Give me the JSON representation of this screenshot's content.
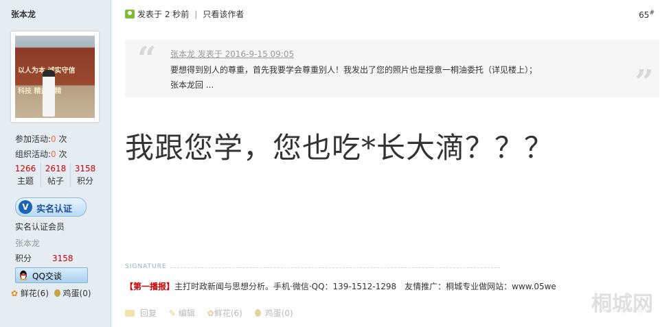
{
  "sidebar": {
    "username": "张本龙",
    "activities": {
      "joined_label": "参加活动:",
      "joined_value": "0",
      "joined_unit": " 次",
      "organized_label": "组织活动:",
      "organized_value": "0",
      "organized_unit": " 次"
    },
    "counts": [
      {
        "value": "1266",
        "label": "主题"
      },
      {
        "value": "2618",
        "label": "帖子"
      },
      {
        "value": "3158",
        "label": "积分"
      }
    ],
    "verify_badge": "实名认证",
    "member_type": "实名认证会员",
    "name_grey": "张本龙",
    "points_label": "积分",
    "points_value": "3158",
    "qq_button": "QQ交谈",
    "flowers": "鲜花(6)",
    "eggs": "鸡蛋(0)"
  },
  "post": {
    "posted_label": "发表于 2 秒前",
    "author_only": "只看该作者",
    "floor_number": "65",
    "floor_mark": "#",
    "quote": {
      "header": "张本龙 发表于 2016-9-15 09:05",
      "body_line1": "要想得到别人的尊重，首先我要学会尊重别人！我发出了您的照片也是授意一桐油委托（详见楼上）；",
      "body_line2": "张本龙回 ..."
    },
    "content": "我跟您学，您也吃*长大滴？？？",
    "signature_label": "SIGNATURE",
    "signature_brand": "【第一播报】",
    "signature_text": "主打时政新闻与思想分析。手机·微信·QQ：139-1512-1298　友情推广：桐城专业做网站：www.05we",
    "actions": {
      "reply": "回复",
      "edit": "编辑",
      "flowers": "鲜花(6)",
      "eggs": "鸡蛋(0)"
    },
    "watermark": "桐城网",
    "watermark_url": "www.tongcheng.cc"
  },
  "colors": {
    "sidebar_bg": "#e5edf2",
    "count_value": "#cc0000",
    "activity_num": "#f26c4f",
    "accent_blue": "#1e63b8"
  }
}
